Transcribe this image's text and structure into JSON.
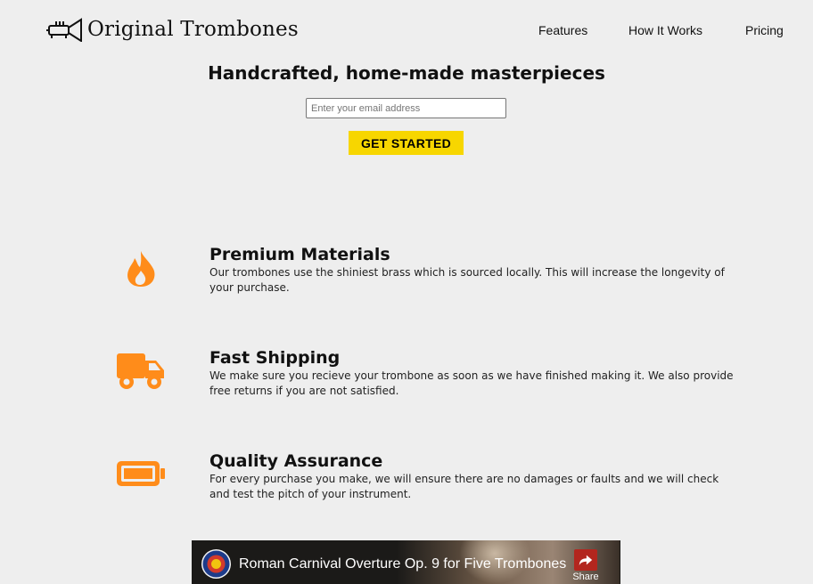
{
  "header": {
    "brand": "Original Trombones",
    "nav": [
      {
        "label": "Features"
      },
      {
        "label": "How It Works"
      },
      {
        "label": "Pricing"
      }
    ]
  },
  "hero": {
    "title": "Handcrafted, home-made masterpieces",
    "email_placeholder": "Enter your email address",
    "cta_label": "GET STARTED"
  },
  "features": [
    {
      "icon": "fire-icon",
      "title": "Premium Materials",
      "description": "Our trombones use the shiniest brass which is sourced locally. This will increase the longevity of your purchase."
    },
    {
      "icon": "truck-icon",
      "title": "Fast Shipping",
      "description": "We make sure you recieve your trombone as soon as we have finished making it. We also provide free returns if you are not satisfied."
    },
    {
      "icon": "battery-icon",
      "title": "Quality Assurance",
      "description": "For every purchase you make, we will ensure there are no damages or faults and we will check and test the pitch of your instrument."
    }
  ],
  "video": {
    "title": "Roman Carnival Overture Op. 9 for Five Trombones",
    "share_label": "Share"
  },
  "colors": {
    "accent": "#f7d600",
    "icon": "#ff8c1a",
    "background": "#eeeeee"
  }
}
